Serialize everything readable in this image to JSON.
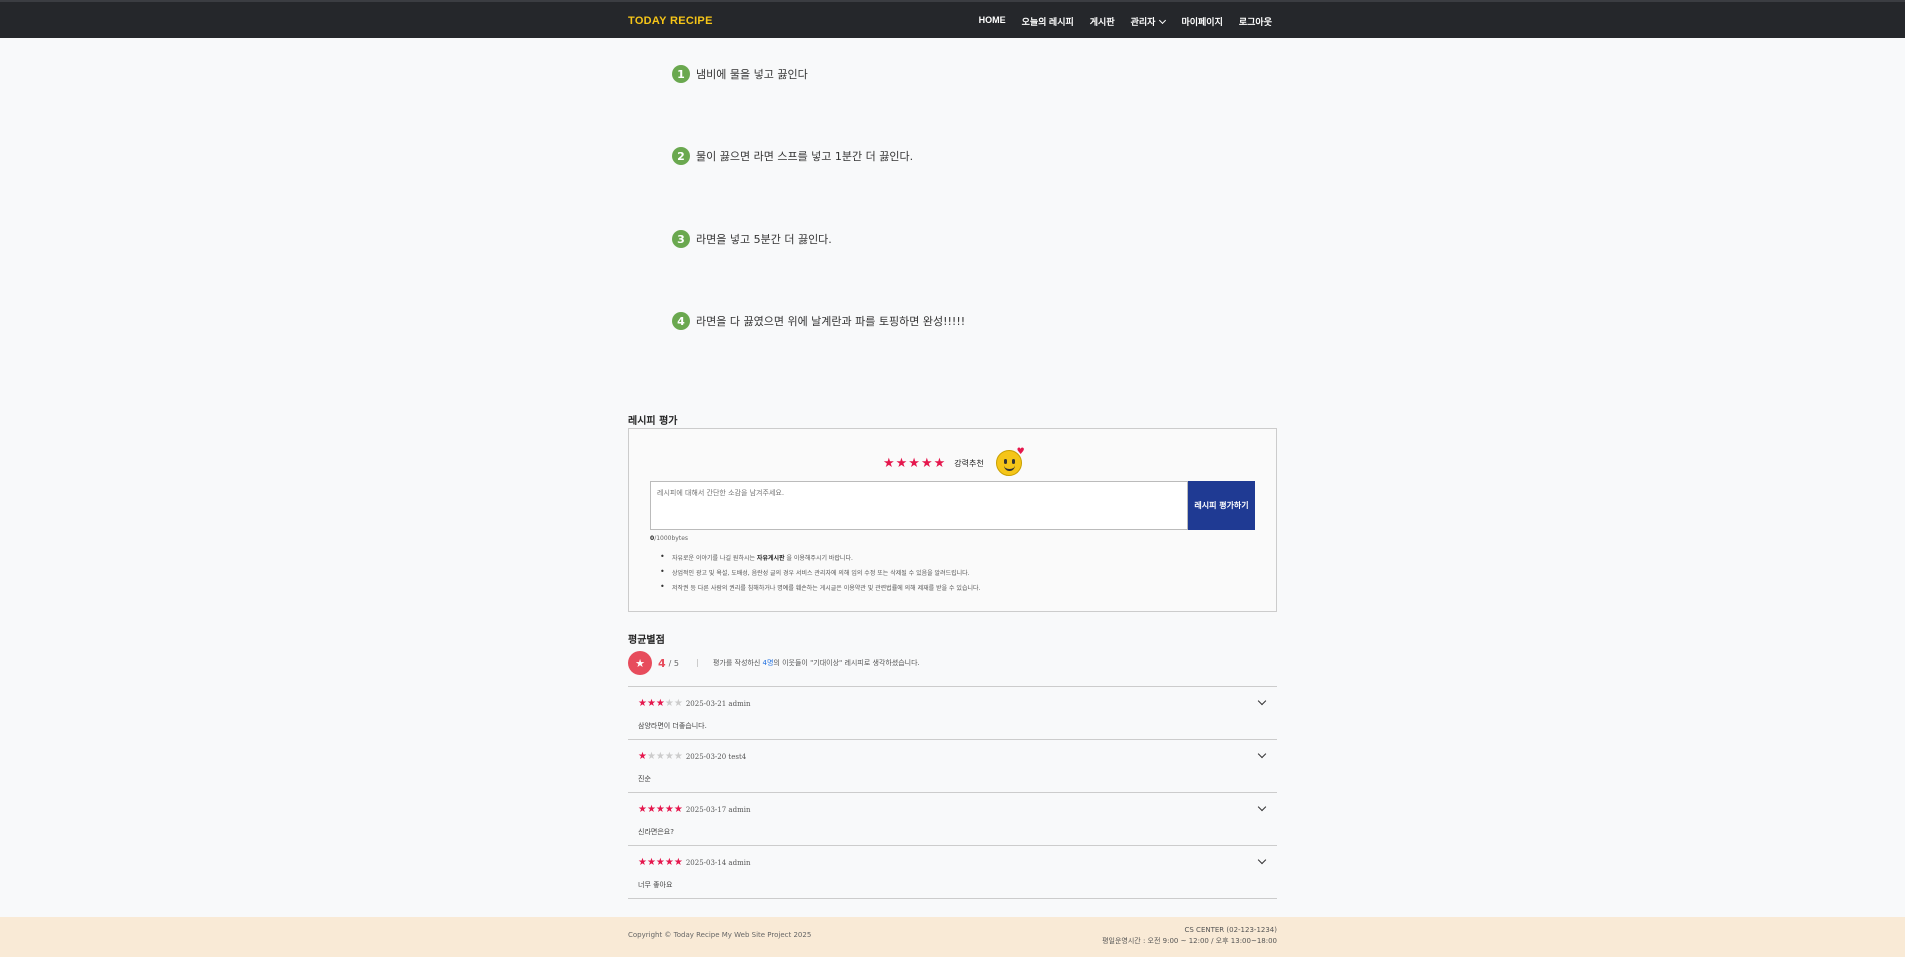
{
  "header": {
    "brand": "TODAY RECIPE",
    "nav": [
      "HOME",
      "오늘의 레시피",
      "게시판",
      "관리자",
      "마이페이지",
      "로그아웃"
    ]
  },
  "steps": [
    {
      "num": "1",
      "text": "냄비에 물을 넣고 끓인다"
    },
    {
      "num": "2",
      "text": "물이 끓으면 라면 스프를 넣고 1분간 더 끓인다."
    },
    {
      "num": "3",
      "text": "라면을 넣고 5분간 더 끓인다."
    },
    {
      "num": "4",
      "text": "라면을 다 끓였으면 위에 날계란과 파를 토핑하면 완성!!!!!"
    }
  ],
  "rating_section": {
    "title": "레시피 평가",
    "stars": "★★★★★",
    "rec_label": "강력추천",
    "input_placeholder": "레시피에 대해서 간단한 소감을 남겨주세요.",
    "submit_label": "레시피 평가하기",
    "bytes_count": "0",
    "bytes_max": "/1000bytes",
    "notices": [
      {
        "pre": "자유로운 이야기를 나길 원하시는 ",
        "bold": "자유게시판",
        "post": " 을 이용해주시기 바랍니다."
      },
      {
        "pre": "상업적인 광고 및 욕설, 도배성, 음란성 글의 경우 서비스 관리자에 의해 임의 수정 또는 삭제될 수 있음을 알려드립니다.",
        "bold": "",
        "post": ""
      },
      {
        "pre": "저작권 등 다른 사람의 권리를 침해하거나 명예를 훼손하는 게시글은 이용약관 및 관련법률에 의해 제재를 받을 수 있습니다.",
        "bold": "",
        "post": ""
      }
    ]
  },
  "average": {
    "title": "평균별점",
    "icon": "★",
    "score": "4",
    "out_of": "/ 5",
    "desc_pre": "평가를 작성하신 ",
    "desc_count": "4명",
    "desc_post": "의 이웃들이 \"기대이상\" 레시피로 생각하셨습니다."
  },
  "reviews": [
    {
      "stars_on": "★★★",
      "stars_off": "★★",
      "meta": "2025-03-21  admin",
      "body": "삼양라면이 더좋습니다."
    },
    {
      "stars_on": "★",
      "stars_off": "★★★★",
      "meta": "2025-03-20  test4",
      "body": "진순"
    },
    {
      "stars_on": "★★★★★",
      "stars_off": "",
      "meta": "2025-03-17  admin",
      "body": "신라면은요?"
    },
    {
      "stars_on": "★★★★★",
      "stars_off": "",
      "meta": "2025-03-14  admin",
      "body": "너무 좋아요"
    }
  ],
  "footer": {
    "copyright": "Copyright © Today Recipe My Web Site Project 2025",
    "cs_center": "CS CENTER (02-123-1234)",
    "hours": "평일운영시간 : 오전 9:00 ~ 12:00 / 오후 13:00~18:00"
  },
  "colors": {
    "accent": "#1f3a93",
    "star": "#e5174d",
    "step": "#6aa84f",
    "brand": "#f5c518"
  }
}
